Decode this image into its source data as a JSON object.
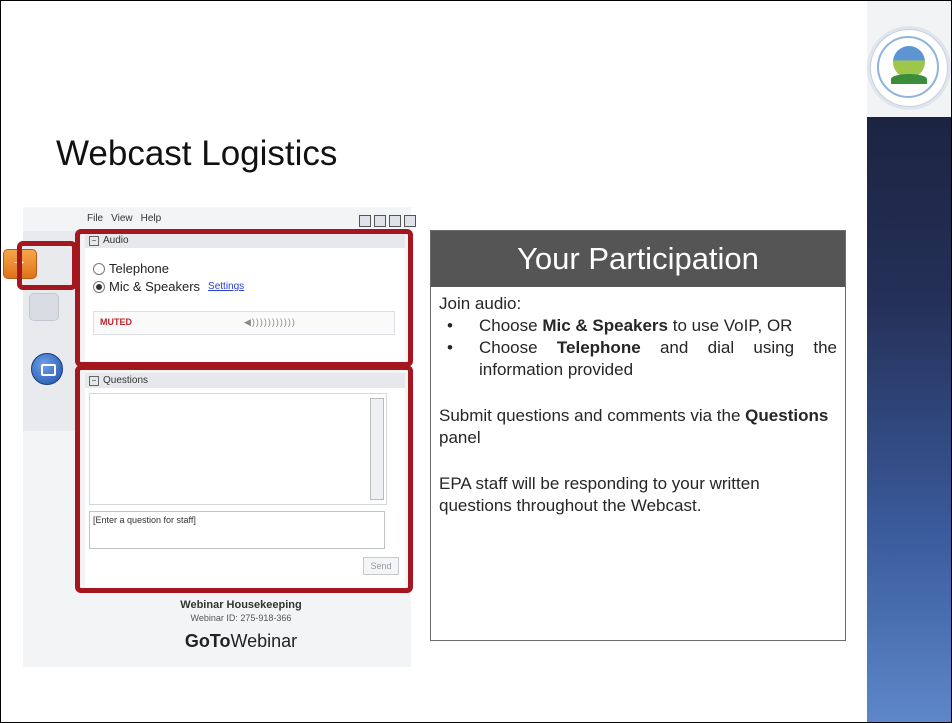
{
  "slide": {
    "title": "Webcast Logistics"
  },
  "gotowebinar": {
    "menu": [
      "File",
      "View",
      "Help"
    ],
    "audio": {
      "header": "Audio",
      "option_telephone": "Telephone",
      "option_mic": "Mic & Speakers",
      "selected": "Mic & Speakers",
      "settings_link": "Settings",
      "status": "MUTED",
      "volume_meter": "◀)))))))))))"
    },
    "questions": {
      "header": "Questions",
      "input_placeholder": "[Enter a question for staff]",
      "send_label": "Send"
    },
    "footer": {
      "title": "Webinar Housekeeping",
      "webinar_id": "Webinar ID: 275-918-366",
      "logo_bold": "GoTo",
      "logo_regular": "Webinar"
    }
  },
  "participation": {
    "header": "Your Participation",
    "intro": "Join audio:",
    "bullet1_pre": "Choose ",
    "bullet1_bold": "Mic & Speakers",
    "bullet1_post": " to use VoIP, OR",
    "bullet2_pre": "Choose ",
    "bullet2_bold": "Telephone",
    "bullet2_post": " and dial using the information provided",
    "submit_pre": "Submit questions and comments via the ",
    "submit_bold": "Questions",
    "submit_post": " panel",
    "staff_note": "EPA staff will be responding to your written questions throughout the Webcast."
  },
  "colors": {
    "highlight_red": "#a5171e",
    "header_gray": "#555555"
  },
  "icons": [
    "epa-seal-icon",
    "arrow-icon",
    "microphone-icon",
    "questions-icon"
  ]
}
